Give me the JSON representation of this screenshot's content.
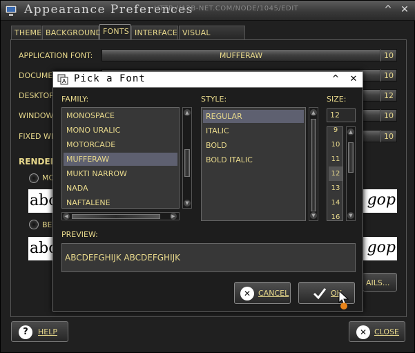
{
  "window": {
    "title": "Appearance Preferences",
    "url": "HTTP://A2B-NET.COM/NODE/1045/EDIT",
    "minimize": "^",
    "close": "✕"
  },
  "tabs": [
    {
      "label": "THEME"
    },
    {
      "label": "BACKGROUND"
    },
    {
      "label": "FONTS",
      "active": true
    },
    {
      "label": "INTERFACE"
    },
    {
      "label": "VISUAL EFFECTS"
    }
  ],
  "fonts_tab": {
    "rows": [
      {
        "label": "APPLICATION FONT:",
        "font": "MUFFERAW",
        "size": "10"
      },
      {
        "label": "DOCUMEN",
        "font": "",
        "size": "10"
      },
      {
        "label": "DESKTOP",
        "font": "",
        "size": "12"
      },
      {
        "label": "WINDOW T",
        "font": "",
        "size": "10"
      },
      {
        "label": "FIXED WID",
        "font": "",
        "size": "10"
      }
    ],
    "rendering_label": "RENDER",
    "option1_label": "MO",
    "option2_label": "BE",
    "sample_left": "abc",
    "sample_right": "gop",
    "details_label": "AILS..."
  },
  "footer": {
    "help_label": "HELP",
    "close_label": "CLOSE"
  },
  "dialog": {
    "title": "Pick a Font",
    "minimize": "^",
    "close": "✕",
    "family_label": "FAMILY:",
    "style_label": "STYLE:",
    "size_label": "SIZE:",
    "families": [
      "MONOSPACE",
      "MONO URALIC",
      "MOTORCADE",
      "MUFFERAW",
      "MUKTI NARROW",
      "NADA",
      "NAFTALENE"
    ],
    "selected_family": "MUFFERAW",
    "styles": [
      "REGULAR",
      "ITALIC",
      "BOLD",
      "BOLD ITALIC"
    ],
    "selected_style": "REGULAR",
    "size_value": "12",
    "sizes": [
      "9",
      "10",
      "11",
      "12",
      "13",
      "14",
      "16"
    ],
    "selected_size": "12",
    "preview_label": "PREVIEW:",
    "preview_text": "ABCDEFGHIJK ABCDEFGHIJK",
    "cancel_label": "CANCEL",
    "ok_label": "OK"
  }
}
